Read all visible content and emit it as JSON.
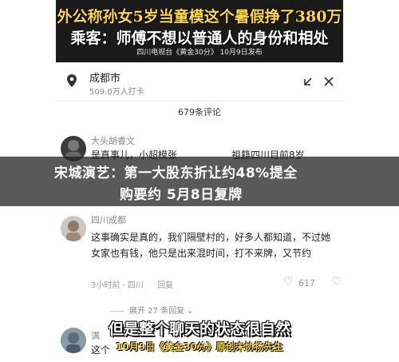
{
  "video": {
    "caption_line1": "外公称孙女5岁当童模这个暑假挣了380万",
    "caption_line2": "乘客：师傅不想以普通人的身份和相处",
    "source": "四川电视台《黄金30分》 10月9日发布"
  },
  "location": {
    "city": "成都市",
    "visits": "509.0万人打卡",
    "pin_icon": "location-pin-icon",
    "minimize_icon": "minimize-icon",
    "close_icon": "close-icon"
  },
  "comments_header": {
    "count": "679条评论"
  },
  "comments": [
    {
      "username": "大头胡睿文",
      "text_left": "是真事儿，小超模张",
      "text_right": "祖籍四川目前8岁"
    },
    {
      "username": "四川成都",
      "text": "这事确实是真的，我们隔壁村的，好多人都知道，不过她女家也有钱，他只是出来混时间，打不来牌，又节约",
      "meta": "3小时前 · 四川",
      "reply": "回复",
      "likes": "617"
    }
  ],
  "expand": {
    "label": "展开 27 条回复"
  },
  "third_comment_prefix": "满",
  "third_comment_text": "这个",
  "news_banner": {
    "line1": "宋城演艺：第一大股东折让约48%提全",
    "line2": "购要约 5月8日复牌"
  },
  "bottom_subtitle": {
    "line1": "但是整个聊天的状态很自然",
    "line2": "10月9日《黄金30分》原创未协扬先生"
  }
}
